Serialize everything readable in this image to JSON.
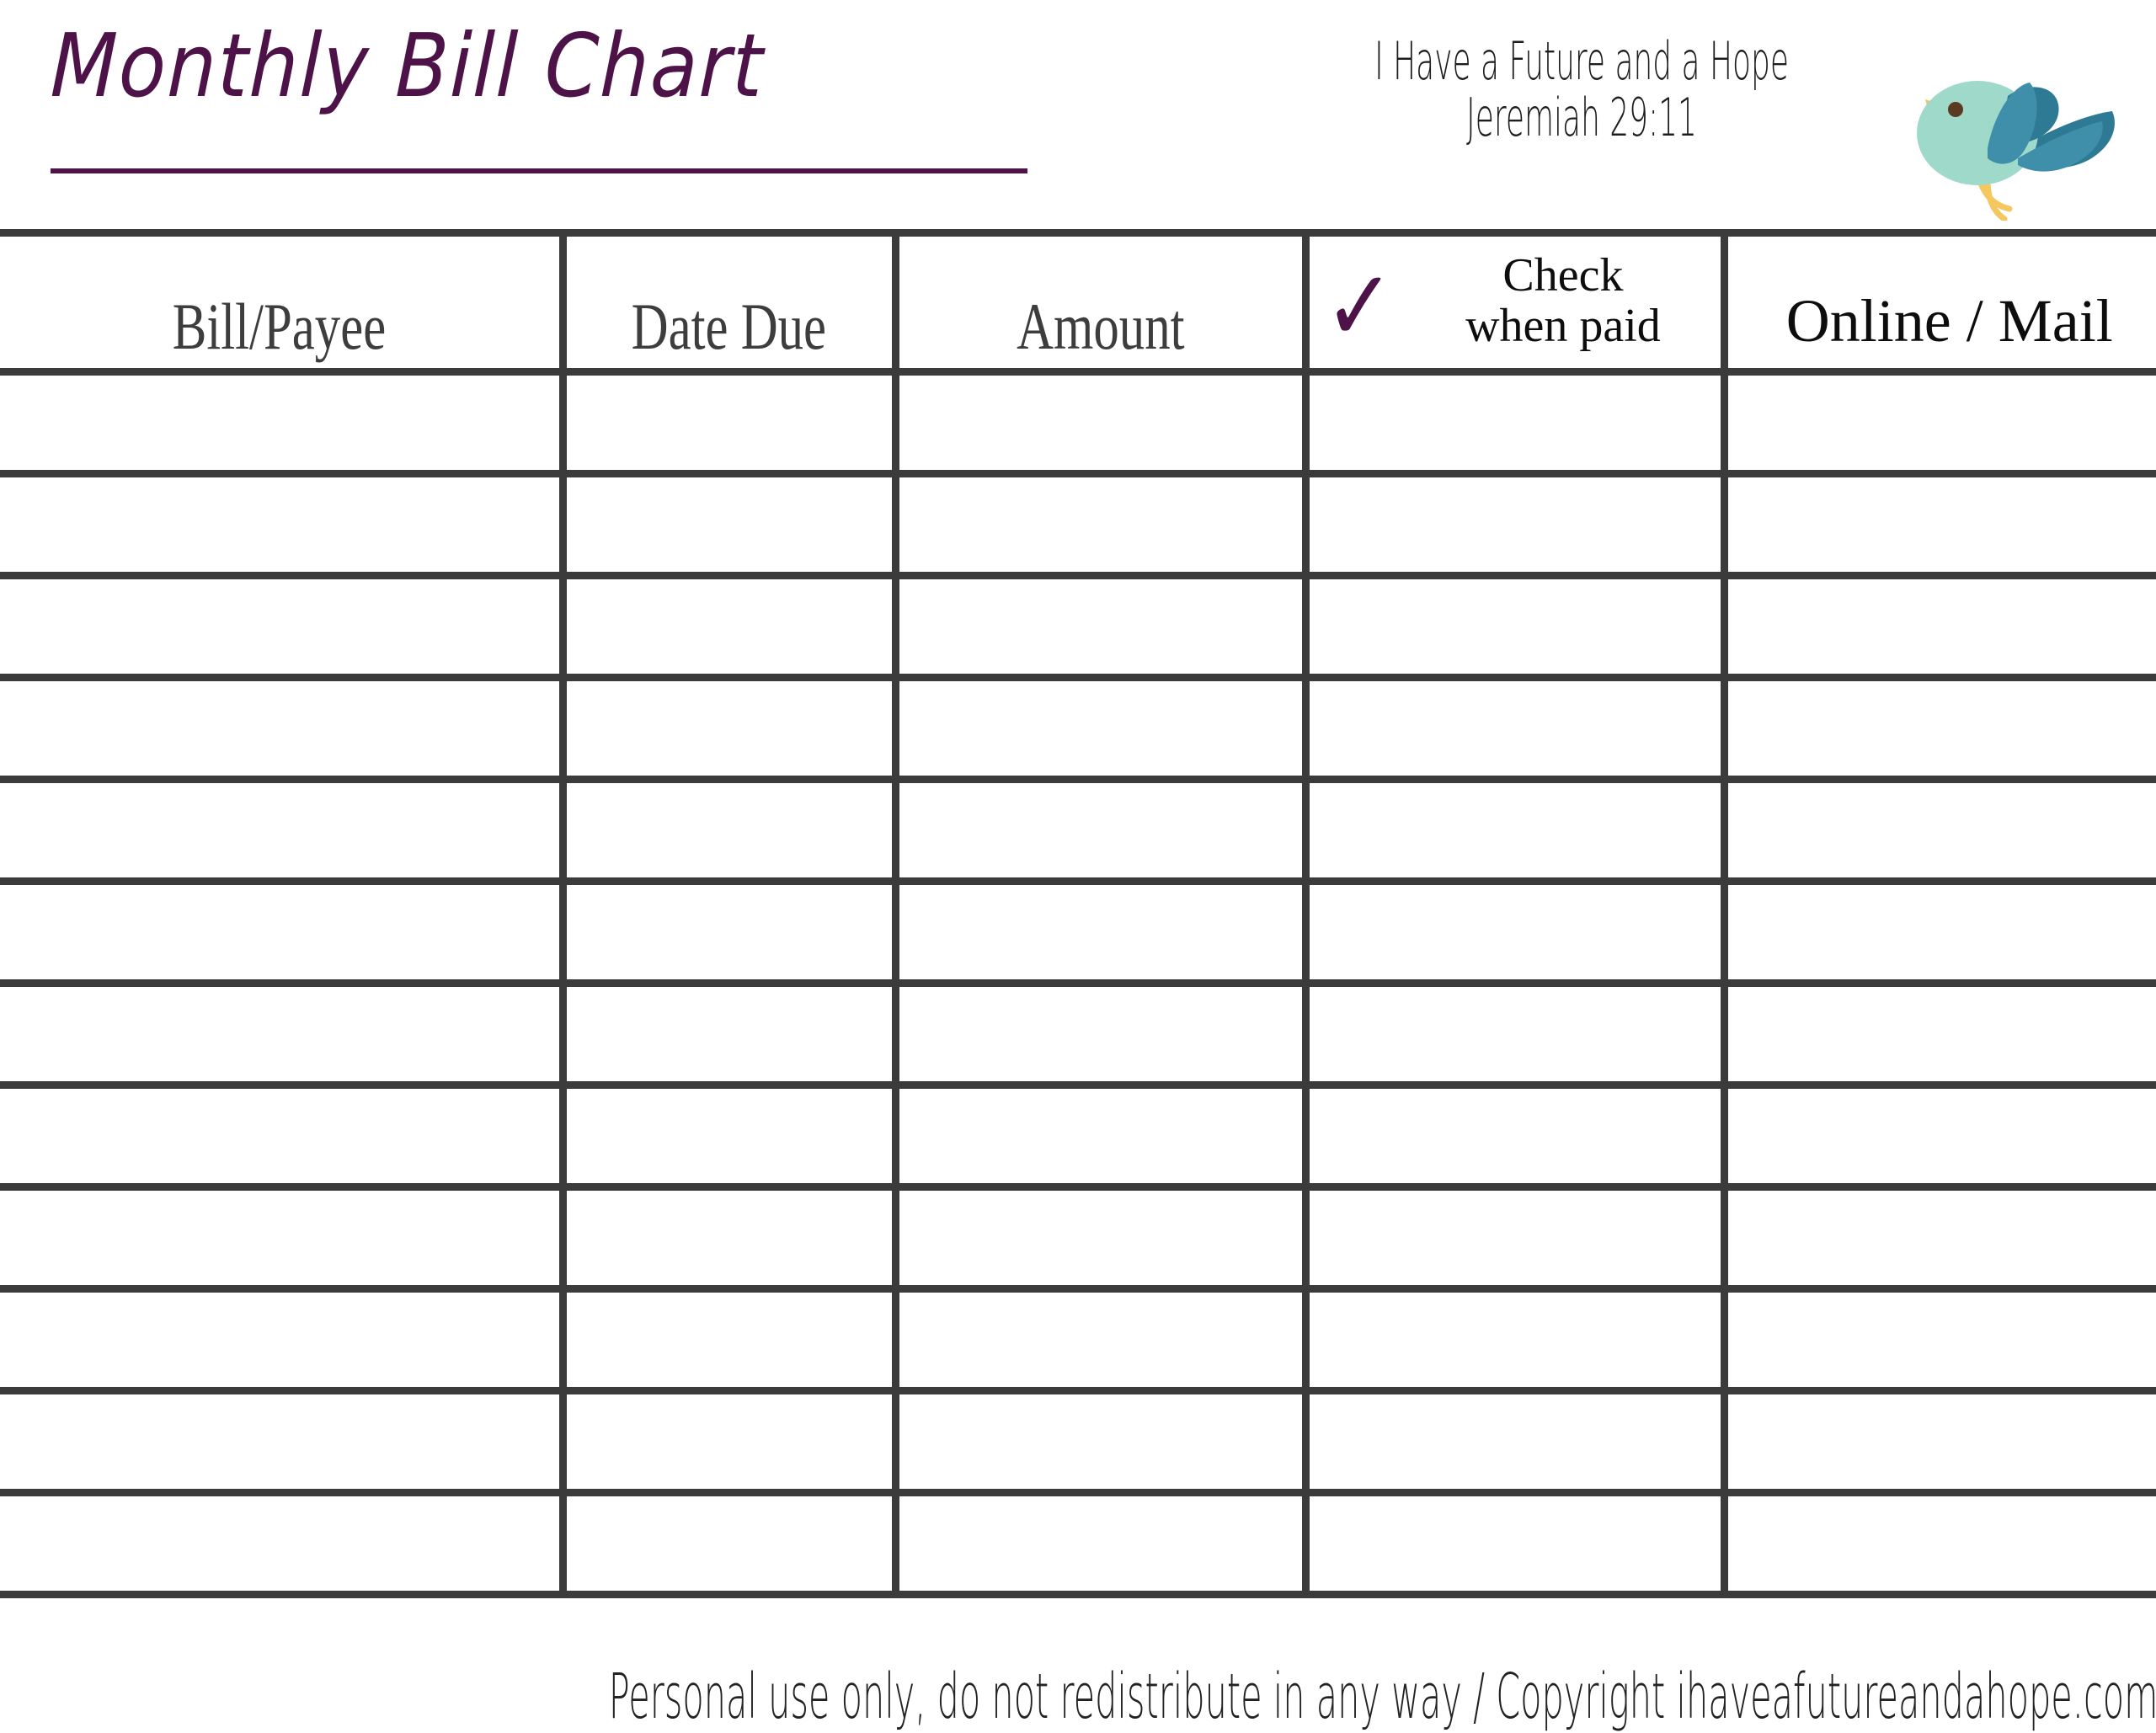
{
  "document": {
    "title": "Monthly Bill Chart",
    "accent_color": "#4D1247",
    "grid_color": "#3B3B3B",
    "background_color": "#FFFFFF"
  },
  "header": {
    "verse_text": "I Have a Future and a Hope",
    "verse_reference": "Jeremiah 29:11",
    "bird": {
      "icon_name": "bird-icon",
      "body_color": "#9FD9CA",
      "wing_color": "#3F8FAA",
      "wing_back_color": "#2E7A95",
      "beak_color": "#F4C75F",
      "leg_color": "#F4C75F",
      "eye_color": "#5A3A20"
    }
  },
  "table": {
    "columns": [
      {
        "key": "bill_payee",
        "label": "Bill/Payee",
        "style": "condensed"
      },
      {
        "key": "date_due",
        "label": "Date Due",
        "style": "condensed"
      },
      {
        "key": "amount",
        "label": "Amount",
        "style": "condensed"
      },
      {
        "key": "check_when_paid",
        "label_line_1": "Check",
        "label_line_2": "when paid",
        "checkmark": "✓",
        "style": "check"
      },
      {
        "key": "online_mail",
        "label": "Online / Mail",
        "style": "plain"
      }
    ],
    "row_count": 12,
    "rows": [
      {
        "bill_payee": "",
        "date_due": "",
        "amount": "",
        "check_when_paid": "",
        "online_mail": ""
      },
      {
        "bill_payee": "",
        "date_due": "",
        "amount": "",
        "check_when_paid": "",
        "online_mail": ""
      },
      {
        "bill_payee": "",
        "date_due": "",
        "amount": "",
        "check_when_paid": "",
        "online_mail": ""
      },
      {
        "bill_payee": "",
        "date_due": "",
        "amount": "",
        "check_when_paid": "",
        "online_mail": ""
      },
      {
        "bill_payee": "",
        "date_due": "",
        "amount": "",
        "check_when_paid": "",
        "online_mail": ""
      },
      {
        "bill_payee": "",
        "date_due": "",
        "amount": "",
        "check_when_paid": "",
        "online_mail": ""
      },
      {
        "bill_payee": "",
        "date_due": "",
        "amount": "",
        "check_when_paid": "",
        "online_mail": ""
      },
      {
        "bill_payee": "",
        "date_due": "",
        "amount": "",
        "check_when_paid": "",
        "online_mail": ""
      },
      {
        "bill_payee": "",
        "date_due": "",
        "amount": "",
        "check_when_paid": "",
        "online_mail": ""
      },
      {
        "bill_payee": "",
        "date_due": "",
        "amount": "",
        "check_when_paid": "",
        "online_mail": ""
      },
      {
        "bill_payee": "",
        "date_due": "",
        "amount": "",
        "check_when_paid": "",
        "online_mail": ""
      },
      {
        "bill_payee": "",
        "date_due": "",
        "amount": "",
        "check_when_paid": "",
        "online_mail": ""
      }
    ]
  },
  "footer": {
    "notice": "Personal use only, do not redistribute in any way / Copyright ihaveafutureandahope.com"
  }
}
